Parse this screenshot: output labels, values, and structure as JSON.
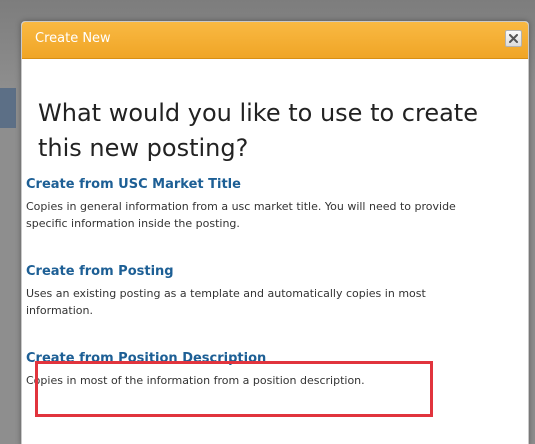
{
  "dialog": {
    "title": "Create New",
    "close_icon": "close-icon",
    "heading": "What would you like to use to create this new posting?",
    "options": [
      {
        "label": "Create from USC Market Title",
        "description": "Copies in general information from a usc market title. You will need to provide specific information inside the posting."
      },
      {
        "label": "Create from Posting",
        "description": "Uses an existing posting as a template and automatically copies in most information."
      },
      {
        "label": "Create from Position Description",
        "description": "Copies in most of the information from a position description."
      }
    ]
  },
  "colors": {
    "titlebar": "#f0a526",
    "link": "#1d5f95",
    "highlight": "#e1343d"
  }
}
